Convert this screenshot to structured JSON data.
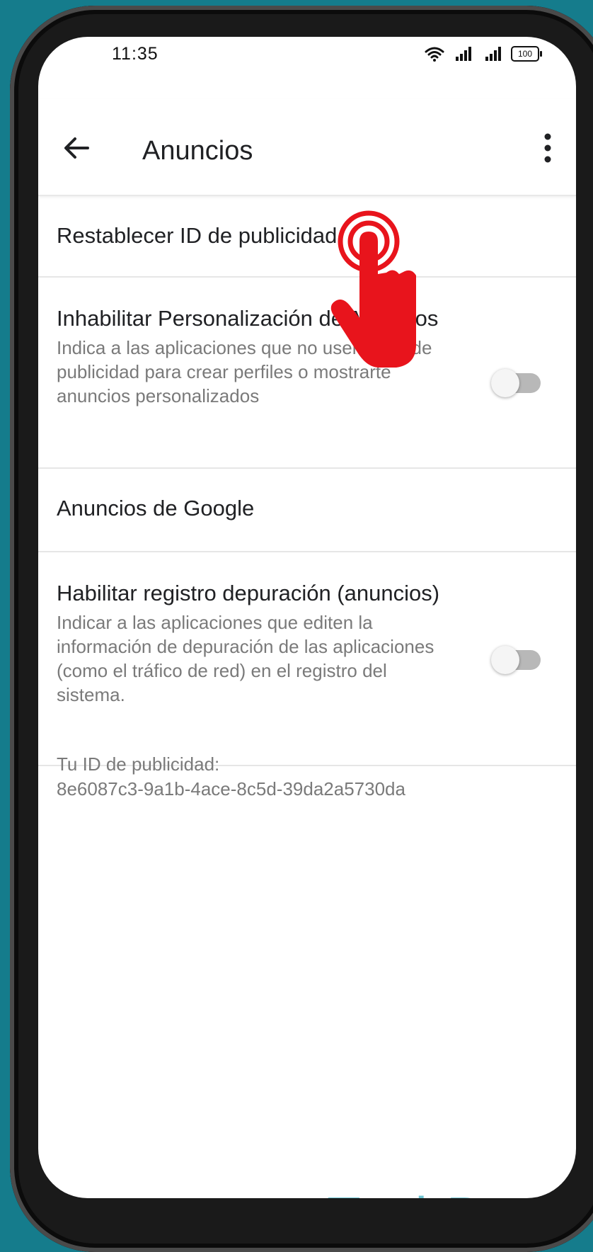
{
  "status_bar": {
    "time": "11:35",
    "battery": "100",
    "icons": [
      "wifi-icon",
      "signal-icon",
      "signal-icon",
      "battery-icon"
    ]
  },
  "app_bar": {
    "title": "Anuncios",
    "back_icon": "arrow-left-icon",
    "more_icon": "more-vert-icon"
  },
  "settings": {
    "reset_id": "Restablecer ID de publicidad",
    "opt_out": {
      "title": "Inhabilitar Personalización de Anuncios",
      "subtitle": "Indica a las aplicaciones que no usen tu ID de publicidad para crear perfiles o mostrarte anuncios personalizados",
      "enabled": false
    },
    "google_ads": "Anuncios de Google",
    "debug_log": {
      "title": "Habilitar registro depuración (anuncios)",
      "subtitle": "Indicar a las aplicaciones que editen la información de depuración de las aplicaciones (como el tráfico de red) en el registro del sistema.",
      "enabled": false
    }
  },
  "ad_id": {
    "label": "Tu ID de publicidad:",
    "value": "8e6087c3-9a1b-4ace-8c5d-39da2a5730da"
  },
  "overlay": {
    "pointer_icon": "tap-hand-icon",
    "pointer_color": "#e8141c"
  },
  "watermark": "TechBone",
  "colors": {
    "background": "#157c8c",
    "watermark": "#6cc4d2",
    "toggle_off": "#b8b8b8"
  }
}
